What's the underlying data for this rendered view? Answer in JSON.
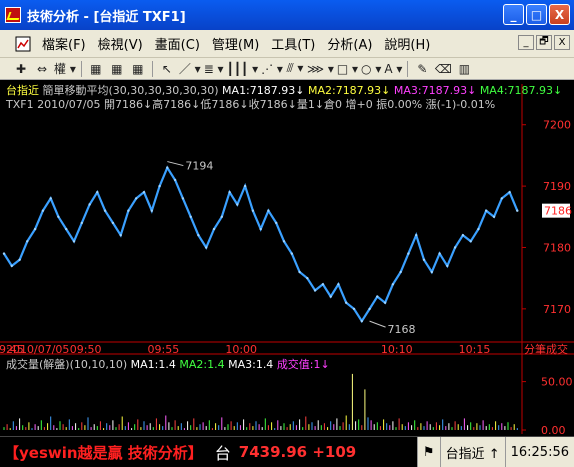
{
  "window": {
    "title": "技術分析 - [台指近 TXF1]",
    "buttons": [
      "_",
      "□",
      "X"
    ]
  },
  "menu": {
    "items": [
      "檔案(F)",
      "檢視(V)",
      "畫面(C)",
      "管理(M)",
      "工具(T)",
      "分析(A)",
      "說明(H)"
    ],
    "mdi_buttons": [
      "_",
      "🗗",
      "X"
    ]
  },
  "toolbar": {
    "items": [
      {
        "name": "crosshair-icon",
        "glyph": "✚"
      },
      {
        "name": "remove-icon",
        "glyph": "⇔"
      },
      {
        "name": "rights-select",
        "glyph": "權 ▾"
      },
      {
        "name": "grid-icon",
        "glyph": "▦"
      },
      {
        "name": "grid2-icon",
        "glyph": "▦"
      },
      {
        "name": "grid3-icon",
        "glyph": "▦"
      },
      {
        "name": "pointer-icon",
        "glyph": "↖"
      },
      {
        "name": "line-icon",
        "glyph": "／ ▾"
      },
      {
        "name": "channel-icon",
        "glyph": "≣ ▾"
      },
      {
        "name": "vlines-icon",
        "glyph": "┃┃┃ ▾"
      },
      {
        "name": "fan-icon",
        "glyph": "⋰ ▾"
      },
      {
        "name": "fib-icon",
        "glyph": "⫻ ▾"
      },
      {
        "name": "pitchfork-icon",
        "glyph": "⋙ ▾"
      },
      {
        "name": "rect-icon",
        "glyph": "□ ▾"
      },
      {
        "name": "ellipse-icon",
        "glyph": "○ ▾"
      },
      {
        "name": "text-icon",
        "glyph": "A ▾"
      },
      {
        "name": "marker-icon",
        "glyph": "✎"
      },
      {
        "name": "eraser-icon",
        "glyph": "⌫"
      },
      {
        "name": "palette-icon",
        "glyph": "▥"
      }
    ]
  },
  "info": {
    "line1": [
      {
        "text": "台指近 ",
        "color": "#ffff40"
      },
      {
        "text": "簡單移動平均(30,30,30,30,30,30) ",
        "color": "#c8c8c8"
      },
      {
        "text": "MA1:7187.93↓ ",
        "color": "#ffffff"
      },
      {
        "text": "MA2:7187.93↓ ",
        "color": "#ffff40"
      },
      {
        "text": "MA3:7187.93↓ ",
        "color": "#ff40ff"
      },
      {
        "text": "MA4:7187.93↓",
        "color": "#40ff40"
      }
    ],
    "line2": "TXF1 2010/07/05 開7186↓高7186↓低7186↓收7186↓量1↓倉0 增+0 振0.00% 漲(-1)-0.01%",
    "line3": [
      {
        "text": "成交量(解盤)(10,10,10) ",
        "color": "#c8c8c8"
      },
      {
        "text": "MA1:1.4 ",
        "color": "#ffffff"
      },
      {
        "text": "MA2:1.4 ",
        "color": "#40ff40"
      },
      {
        "text": "MA3:1.4 ",
        "color": "#ffffff"
      },
      {
        "text": "成交值:1↓",
        "color": "#ff40ff"
      }
    ]
  },
  "chart_data": {
    "type": "line",
    "title": "台指近 TXF1",
    "date": "2010/07/05",
    "x_ticks": [
      "2010/07/05",
      "09:45",
      "09:50",
      "09:55",
      "10:00",
      "10:10",
      "10:15"
    ],
    "x_tick_minutes": [
      45,
      45,
      50,
      55,
      60,
      70,
      75
    ],
    "x_range_minutes": [
      45,
      78.3
    ],
    "y_ticks": [
      7170,
      7180,
      7190,
      7200
    ],
    "ylim": [
      7164.6,
      7202.4
    ],
    "current_price": 7186,
    "annotations": [
      {
        "label": "7194",
        "x": 55.5,
        "y": 7194
      },
      {
        "label": "7168",
        "x": 68.5,
        "y": 7168
      }
    ],
    "series": [
      {
        "color": "#3aa0ff",
        "points": [
          [
            45.0,
            7179
          ],
          [
            45.5,
            7177
          ],
          [
            46.0,
            7178
          ],
          [
            46.5,
            7181
          ],
          [
            47.0,
            7183
          ],
          [
            47.5,
            7186
          ],
          [
            48.0,
            7188
          ],
          [
            48.5,
            7185
          ],
          [
            49.0,
            7183
          ],
          [
            49.5,
            7181
          ],
          [
            50.0,
            7184
          ],
          [
            50.5,
            7187
          ],
          [
            51.0,
            7189
          ],
          [
            51.5,
            7186
          ],
          [
            52.0,
            7184
          ],
          [
            52.5,
            7182
          ],
          [
            53.0,
            7186
          ],
          [
            53.5,
            7188
          ],
          [
            54.0,
            7189
          ],
          [
            54.5,
            7186
          ],
          [
            55.0,
            7190
          ],
          [
            55.5,
            7193
          ],
          [
            56.0,
            7191
          ],
          [
            56.5,
            7188
          ],
          [
            57.0,
            7185
          ],
          [
            57.5,
            7182
          ],
          [
            58.0,
            7180
          ],
          [
            58.5,
            7183
          ],
          [
            59.0,
            7185
          ],
          [
            59.5,
            7189
          ],
          [
            60.0,
            7187
          ],
          [
            60.5,
            7190
          ],
          [
            61.0,
            7186
          ],
          [
            61.5,
            7183
          ],
          [
            62.0,
            7186
          ],
          [
            62.5,
            7184
          ],
          [
            63.0,
            7181
          ],
          [
            63.5,
            7179
          ],
          [
            64.0,
            7176
          ],
          [
            64.5,
            7175
          ],
          [
            65.0,
            7173
          ],
          [
            65.5,
            7174
          ],
          [
            66.0,
            7172
          ],
          [
            66.5,
            7174
          ],
          [
            67.0,
            7171
          ],
          [
            67.5,
            7170
          ],
          [
            68.0,
            7168
          ],
          [
            68.5,
            7170
          ],
          [
            69.0,
            7172
          ],
          [
            69.5,
            7171
          ],
          [
            70.0,
            7174
          ],
          [
            70.5,
            7176
          ],
          [
            71.0,
            7179
          ],
          [
            71.5,
            7182
          ],
          [
            72.0,
            7178
          ],
          [
            72.5,
            7176
          ],
          [
            73.0,
            7179
          ],
          [
            73.5,
            7177
          ],
          [
            74.0,
            7180
          ],
          [
            74.5,
            7182
          ],
          [
            75.0,
            7181
          ],
          [
            75.5,
            7183
          ],
          [
            76.0,
            7186
          ],
          [
            76.5,
            7185
          ],
          [
            77.0,
            7188
          ],
          [
            77.5,
            7189
          ],
          [
            78.0,
            7186
          ]
        ]
      }
    ],
    "volume": {
      "label": "成交量",
      "y_ticks": [
        0,
        50
      ],
      "ylim": [
        0,
        62
      ],
      "bars": [
        [
          45.0,
          3
        ],
        [
          45.2,
          6
        ],
        [
          45.4,
          2
        ],
        [
          45.6,
          9
        ],
        [
          45.8,
          4
        ],
        [
          46.0,
          12
        ],
        [
          46.2,
          5
        ],
        [
          46.4,
          3
        ],
        [
          46.6,
          8
        ],
        [
          46.8,
          2
        ],
        [
          47.0,
          6
        ],
        [
          47.2,
          4
        ],
        [
          47.4,
          10
        ],
        [
          47.6,
          3
        ],
        [
          47.8,
          7
        ],
        [
          48.0,
          14
        ],
        [
          48.2,
          5
        ],
        [
          48.4,
          2
        ],
        [
          48.6,
          9
        ],
        [
          48.8,
          6
        ],
        [
          49.0,
          3
        ],
        [
          49.2,
          11
        ],
        [
          49.4,
          4
        ],
        [
          49.6,
          7
        ],
        [
          49.8,
          2
        ],
        [
          50.0,
          8
        ],
        [
          50.2,
          5
        ],
        [
          50.4,
          13
        ],
        [
          50.6,
          3
        ],
        [
          50.8,
          6
        ],
        [
          51.0,
          4
        ],
        [
          51.2,
          9
        ],
        [
          51.4,
          2
        ],
        [
          51.6,
          7
        ],
        [
          51.8,
          5
        ],
        [
          52.0,
          10
        ],
        [
          52.2,
          3
        ],
        [
          52.4,
          6
        ],
        [
          52.6,
          14
        ],
        [
          52.8,
          4
        ],
        [
          53.0,
          8
        ],
        [
          53.2,
          2
        ],
        [
          53.4,
          6
        ],
        [
          53.6,
          11
        ],
        [
          53.8,
          3
        ],
        [
          54.0,
          9
        ],
        [
          54.2,
          5
        ],
        [
          54.4,
          7
        ],
        [
          54.6,
          3
        ],
        [
          54.8,
          12
        ],
        [
          55.0,
          6
        ],
        [
          55.2,
          4
        ],
        [
          55.4,
          15
        ],
        [
          55.6,
          8
        ],
        [
          55.8,
          3
        ],
        [
          56.0,
          10
        ],
        [
          56.2,
          4
        ],
        [
          56.4,
          7
        ],
        [
          56.6,
          2
        ],
        [
          56.8,
          9
        ],
        [
          57.0,
          5
        ],
        [
          57.2,
          12
        ],
        [
          57.4,
          3
        ],
        [
          57.6,
          6
        ],
        [
          57.8,
          8
        ],
        [
          58.0,
          4
        ],
        [
          58.2,
          10
        ],
        [
          58.4,
          2
        ],
        [
          58.6,
          7
        ],
        [
          58.8,
          5
        ],
        [
          59.0,
          13
        ],
        [
          59.2,
          3
        ],
        [
          59.4,
          6
        ],
        [
          59.6,
          9
        ],
        [
          59.8,
          4
        ],
        [
          60.0,
          8
        ],
        [
          60.2,
          5
        ],
        [
          60.4,
          11
        ],
        [
          60.6,
          3
        ],
        [
          60.8,
          7
        ],
        [
          61.0,
          4
        ],
        [
          61.2,
          9
        ],
        [
          61.4,
          6
        ],
        [
          61.6,
          3
        ],
        [
          61.8,
          12
        ],
        [
          62.0,
          5
        ],
        [
          62.2,
          8
        ],
        [
          62.4,
          2
        ],
        [
          62.6,
          10
        ],
        [
          62.8,
          4
        ],
        [
          63.0,
          7
        ],
        [
          63.2,
          3
        ],
        [
          63.4,
          6
        ],
        [
          63.6,
          9
        ],
        [
          63.8,
          5
        ],
        [
          64.0,
          11
        ],
        [
          64.2,
          3
        ],
        [
          64.4,
          14
        ],
        [
          64.6,
          6
        ],
        [
          64.8,
          8
        ],
        [
          65.0,
          4
        ],
        [
          65.2,
          10
        ],
        [
          65.4,
          5
        ],
        [
          65.6,
          7
        ],
        [
          65.8,
          3
        ],
        [
          66.0,
          9
        ],
        [
          66.2,
          6
        ],
        [
          66.4,
          12
        ],
        [
          66.6,
          4
        ],
        [
          66.8,
          8
        ],
        [
          67.0,
          15
        ],
        [
          67.2,
          6
        ],
        [
          67.4,
          58
        ],
        [
          67.6,
          9
        ],
        [
          67.8,
          11
        ],
        [
          68.0,
          5
        ],
        [
          68.2,
          42
        ],
        [
          68.4,
          13
        ],
        [
          68.6,
          10
        ],
        [
          68.8,
          6
        ],
        [
          69.0,
          8
        ],
        [
          69.2,
          4
        ],
        [
          69.4,
          11
        ],
        [
          69.6,
          7
        ],
        [
          69.8,
          5
        ],
        [
          70.0,
          9
        ],
        [
          70.2,
          3
        ],
        [
          70.4,
          12
        ],
        [
          70.6,
          6
        ],
        [
          70.8,
          4
        ],
        [
          71.0,
          8
        ],
        [
          71.2,
          5
        ],
        [
          71.4,
          10
        ],
        [
          71.6,
          3
        ],
        [
          71.8,
          7
        ],
        [
          72.0,
          4
        ],
        [
          72.2,
          9
        ],
        [
          72.4,
          6
        ],
        [
          72.6,
          3
        ],
        [
          72.8,
          8
        ],
        [
          73.0,
          5
        ],
        [
          73.2,
          11
        ],
        [
          73.4,
          4
        ],
        [
          73.6,
          7
        ],
        [
          73.8,
          3
        ],
        [
          74.0,
          9
        ],
        [
          74.2,
          6
        ],
        [
          74.4,
          4
        ],
        [
          74.6,
          12
        ],
        [
          74.8,
          5
        ],
        [
          75.0,
          8
        ],
        [
          75.2,
          3
        ],
        [
          75.4,
          7
        ],
        [
          75.6,
          5
        ],
        [
          75.8,
          10
        ],
        [
          76.0,
          4
        ],
        [
          76.2,
          6
        ],
        [
          76.4,
          3
        ],
        [
          76.6,
          9
        ],
        [
          76.8,
          5
        ],
        [
          77.0,
          7
        ],
        [
          77.2,
          4
        ],
        [
          77.4,
          8
        ],
        [
          77.6,
          3
        ],
        [
          77.8,
          6
        ],
        [
          78.0,
          2
        ]
      ]
    }
  },
  "right_label": "分筆成交",
  "status": {
    "ticker_text": "【yeswin越是贏 技術分析】",
    "ticker_symbol": "台",
    "ticker_value": "7439.96 +109",
    "symbol_name": "台指近 ↑",
    "time": "16:25:56"
  },
  "colors": {
    "price_line": "#3aa0ff",
    "axis": "#c00000",
    "current_price_bg": "#ffffff",
    "current_price_fg": "#ff2020"
  }
}
